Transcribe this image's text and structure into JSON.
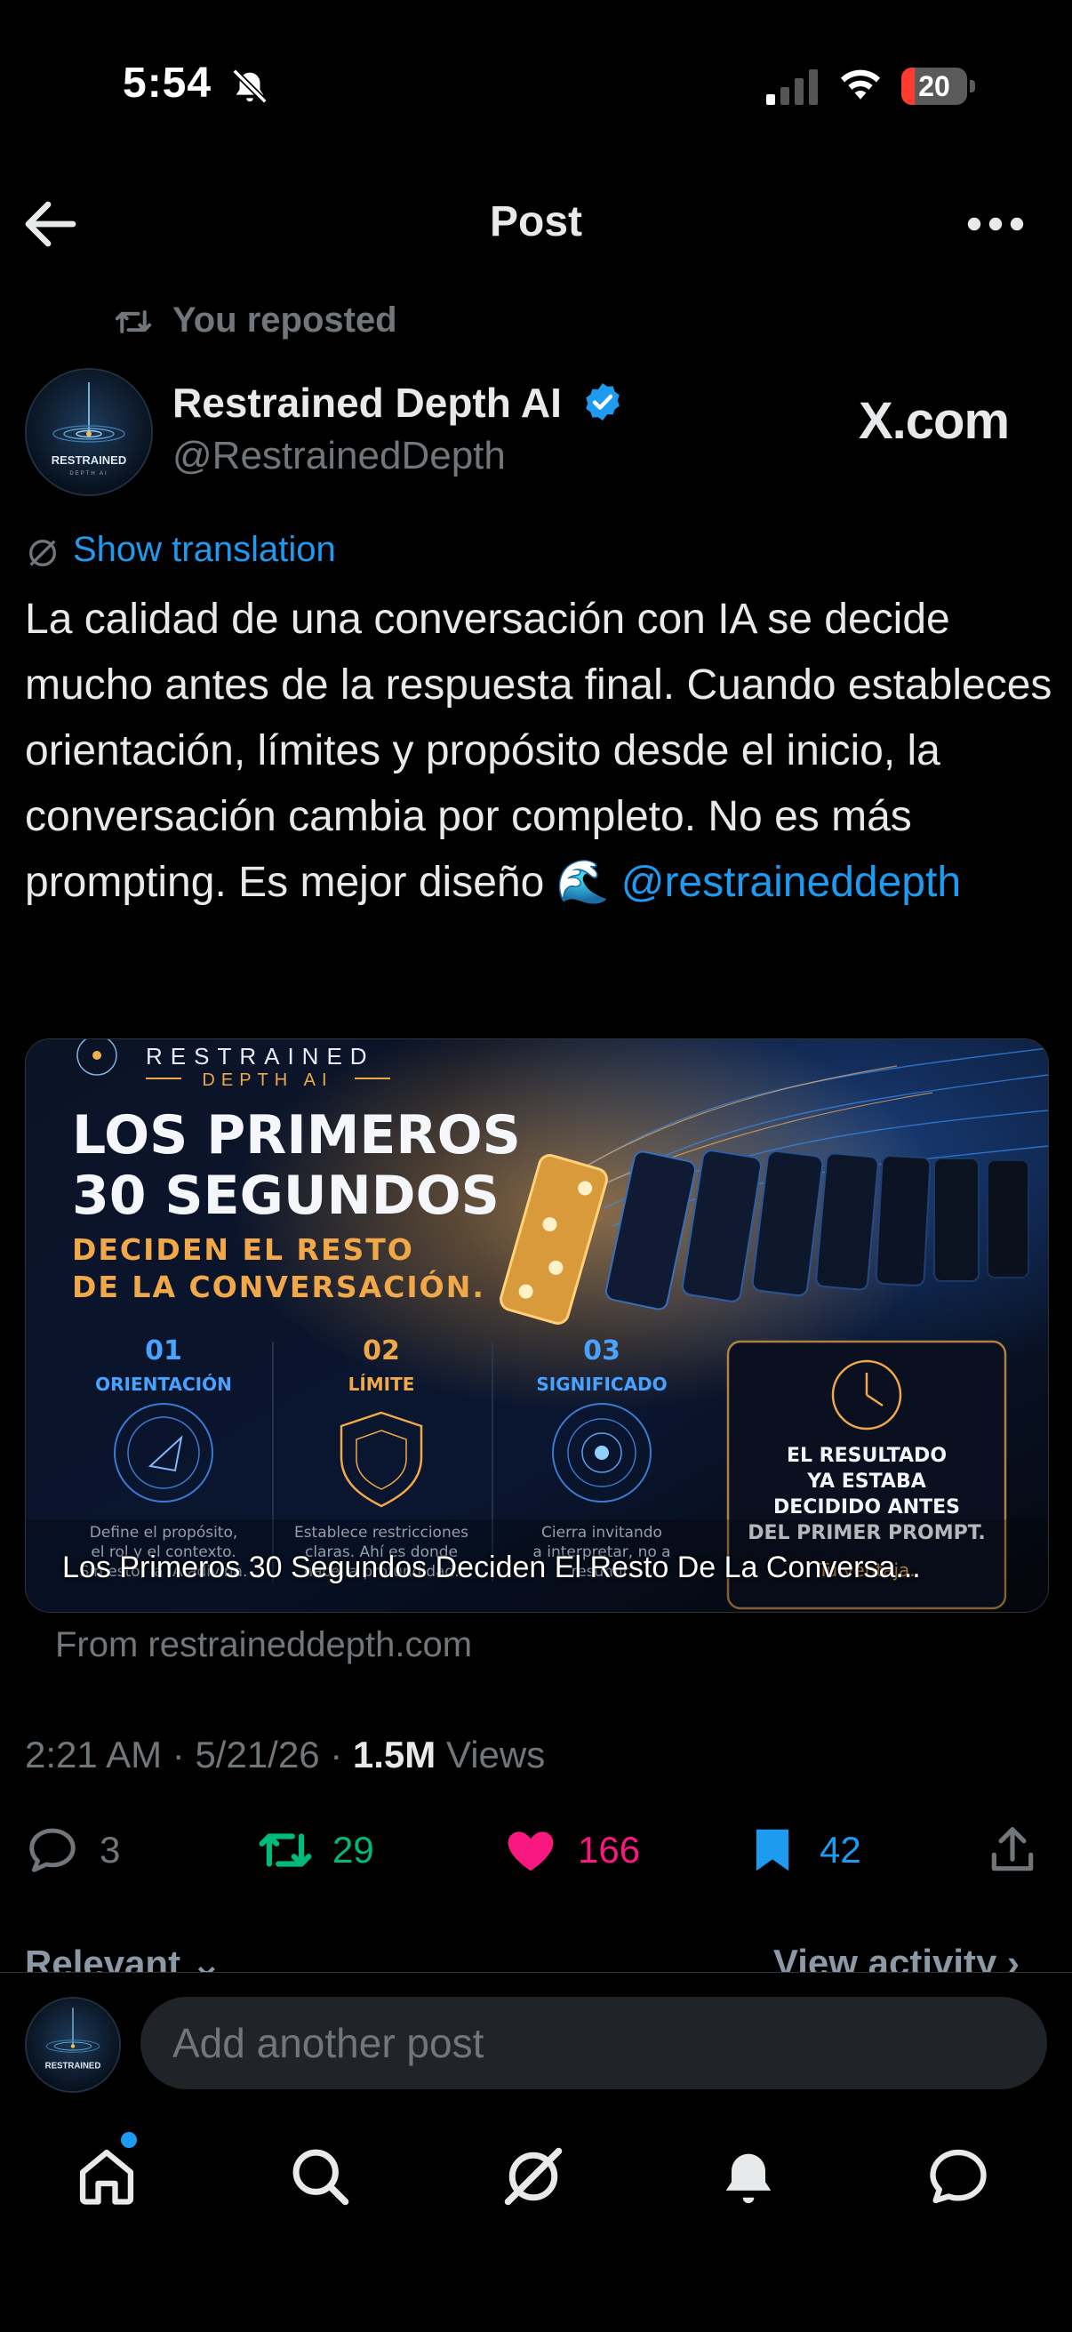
{
  "status_bar": {
    "time": "5:54",
    "battery": "20",
    "battery_fraction": 0.2
  },
  "header": {
    "title": "Post"
  },
  "repost": {
    "label": "You reposted"
  },
  "author": {
    "name": "Restrained Depth AI",
    "handle": "@RestrainedDepth",
    "badge_text": "X.com",
    "avatar_text": "RESTRAINED",
    "avatar_subtext": "DEPTH AI"
  },
  "post": {
    "show_translation": "Show translation",
    "text": "La calidad de una conversación con IA se decide mucho antes de la respuesta final. Cuando estableces orientación, límites y propósito desde el inicio, la conversación cambia por completo. No es más prompting. Es mejor diseño 🌊 ",
    "mention": "@restraineddepth"
  },
  "card": {
    "brand_line1": "RESTRAINED",
    "brand_line2": "DEPTH AI",
    "headline1": "LOS PRIMEROS",
    "headline2": "30 SEGUNDOS",
    "sub1": "DECIDEN EL RESTO",
    "sub2": "DE LA CONVERSACIÓN.",
    "steps": [
      {
        "num": "01",
        "title": "ORIENTACIÓN",
        "desc1": "Define el propósito,",
        "desc2": "el rol y el contexto.",
        "desc3": "Sin esto, la IA adivina."
      },
      {
        "num": "02",
        "title": "LÍMITE",
        "desc1": "Establece restricciones",
        "desc2": "claras. Ahí es donde",
        "desc3": "nace la profundidad."
      },
      {
        "num": "03",
        "title": "SIGNIFICADO",
        "desc1": "Cierra invitando",
        "desc2": "a interpretar, no a",
        "desc3": "resumir."
      }
    ],
    "result1": "EL RESULTADO",
    "result2": "YA ESTABA",
    "result3": "DECIDIDO ANTES",
    "result4": "DEL PRIMER PROMPT.",
    "result5": "Tu ventaja.",
    "caption": "Los Primeros 30 Segundos Deciden El Resto De La Conversa...",
    "source": "From restraineddepth.com"
  },
  "meta": {
    "time": "2:21 AM",
    "date": "5/21/26",
    "views_count": "1.5M",
    "views_label": "Views",
    "separator": " · "
  },
  "actions": {
    "replies": "3",
    "reposts": "29",
    "likes": "166",
    "bookmarks": "42"
  },
  "filters": {
    "relevant": "Relevant",
    "view_activity": "View activity"
  },
  "composer": {
    "placeholder": "Add another post"
  },
  "colors": {
    "accent": "#1d9bf0",
    "repost": "#00ba7c",
    "like": "#f91880",
    "gold": "#f0a848"
  },
  "icons": [
    "back-arrow-icon",
    "more-icon",
    "repost-icon",
    "verified-icon",
    "translate-icon",
    "reply-icon",
    "heart-icon",
    "bookmark-icon",
    "share-icon",
    "home-icon",
    "search-icon",
    "grok-icon",
    "bell-icon",
    "chat-icon"
  ]
}
